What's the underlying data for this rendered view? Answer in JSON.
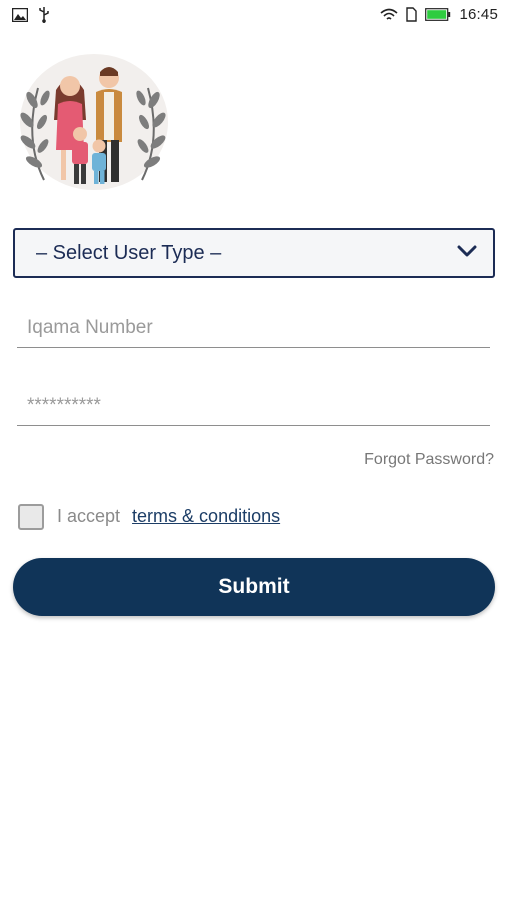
{
  "status_bar": {
    "time": "16:45",
    "left_icons": [
      "image-icon",
      "usb-icon"
    ],
    "right_icons": [
      "wifi-icon",
      "sim-icon",
      "battery-icon"
    ],
    "battery_color": "#2ecc40"
  },
  "logo": {
    "icon": "family-illustration"
  },
  "user_type_select": {
    "label": "– Select User Type –",
    "icon": "chevron-down-icon"
  },
  "iqama_field": {
    "placeholder": "Iqama Number",
    "value": ""
  },
  "password_field": {
    "value": "**********"
  },
  "forgot_password": {
    "label": "Forgot Password?"
  },
  "terms": {
    "checked": false,
    "accept_text": "I accept",
    "link_text": "terms & conditions"
  },
  "submit": {
    "label": "Submit"
  },
  "colors": {
    "primary": "#103458",
    "select_border": "#1c2c55",
    "link": "#1c3d66"
  }
}
